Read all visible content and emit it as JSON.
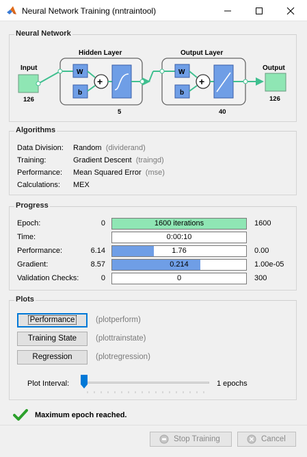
{
  "window": {
    "title": "Neural Network Training (nntraintool)",
    "icon": "matlab-logo-icon"
  },
  "network": {
    "section_title": "Neural Network",
    "input_label": "Input",
    "input_size": "126",
    "hidden_title": "Hidden Layer",
    "hidden_size": "5",
    "output_layer_title": "Output Layer",
    "output_layer_size": "40",
    "output_label": "Output",
    "output_size": "126",
    "weight_label": "W",
    "bias_label": "b",
    "colors": {
      "io_fill": "#8fe6b4",
      "block_fill": "#6f9ee6",
      "layer_bg": "#f2f2f2"
    }
  },
  "algorithms": {
    "section_title": "Algorithms",
    "rows": [
      {
        "label": "Data Division:",
        "value": "Random",
        "fn": "(dividerand)"
      },
      {
        "label": "Training:",
        "value": "Gradient Descent",
        "fn": "(traingd)"
      },
      {
        "label": "Performance:",
        "value": "Mean Squared Error",
        "fn": "(mse)"
      },
      {
        "label": "Calculations:",
        "value": "MEX",
        "fn": ""
      }
    ]
  },
  "progress": {
    "section_title": "Progress",
    "rows": [
      {
        "label": "Epoch:",
        "start": "0",
        "bar_text": "1600 iterations",
        "end": "1600",
        "fill_fraction": 1.0,
        "fill_color": "#8fe6b4"
      },
      {
        "label": "Time:",
        "start": "",
        "bar_text": "0:00:10",
        "end": "",
        "fill_fraction": 0,
        "fill_color": "#6f9ee6"
      },
      {
        "label": "Performance:",
        "start": "6.14",
        "bar_text": "1.76",
        "end": "0.00",
        "fill_fraction": 0.31,
        "fill_color": "#6f9ee6"
      },
      {
        "label": "Gradient:",
        "start": "8.57",
        "bar_text": "0.214",
        "end": "1.00e-05",
        "fill_fraction": 0.66,
        "fill_color": "#6f9ee6"
      },
      {
        "label": "Validation Checks:",
        "start": "0",
        "bar_text": "0",
        "end": "300",
        "fill_fraction": 0,
        "fill_color": "#6f9ee6"
      }
    ]
  },
  "plots": {
    "section_title": "Plots",
    "buttons": [
      {
        "label": "Performance",
        "fn": "(plotperform)",
        "focused": true
      },
      {
        "label": "Training State",
        "fn": "(plottrainstate)",
        "focused": false
      },
      {
        "label": "Regression",
        "fn": "(plotregression)",
        "focused": false
      }
    ],
    "interval_label": "Plot Interval:",
    "interval_value": "1 epochs",
    "interval_fraction": 0.0
  },
  "status": {
    "icon": "checkmark-icon",
    "text": "Maximum epoch reached."
  },
  "footer": {
    "stop_label": "Stop Training",
    "cancel_label": "Cancel"
  }
}
